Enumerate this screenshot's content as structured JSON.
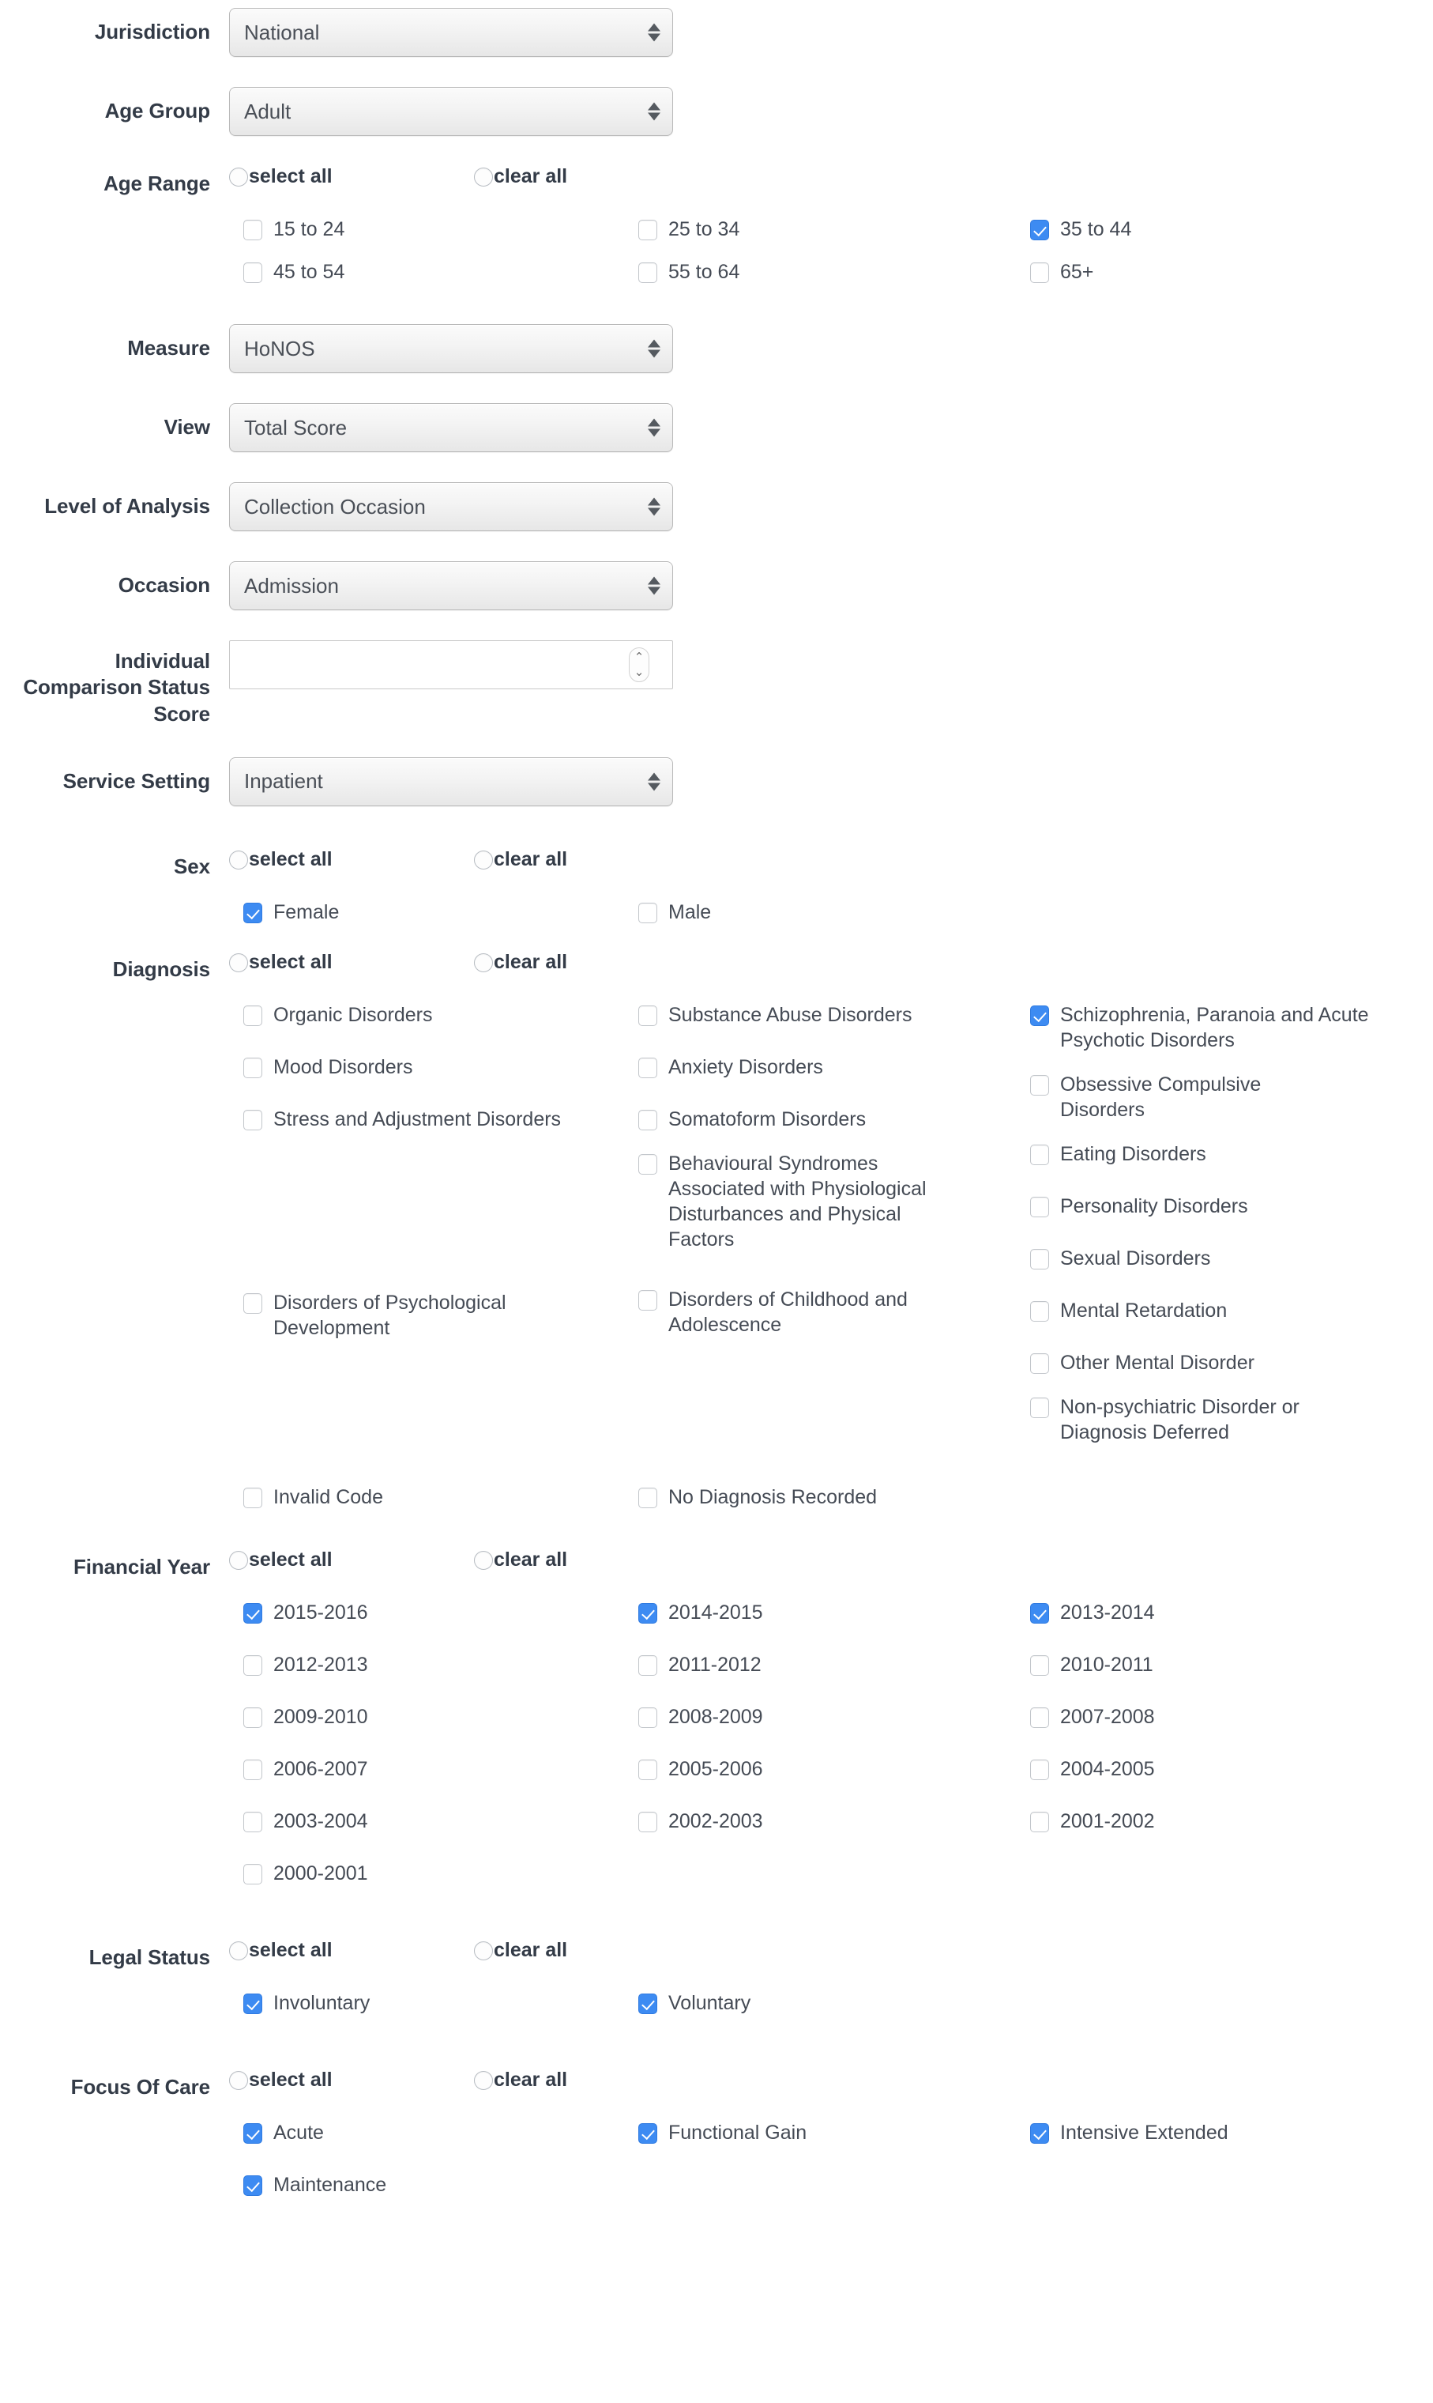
{
  "common": {
    "select_all": "select all",
    "clear_all": "clear all"
  },
  "fields": {
    "jurisdiction": {
      "label": "Jurisdiction",
      "value": "National"
    },
    "age_group": {
      "label": "Age Group",
      "value": "Adult"
    },
    "measure": {
      "label": "Measure",
      "value": "HoNOS"
    },
    "view": {
      "label": "View",
      "value": "Total Score"
    },
    "level_of_analysis": {
      "label": "Level of Analysis",
      "value": "Collection Occasion"
    },
    "occasion": {
      "label": "Occasion",
      "value": "Admission"
    },
    "individual_comparison_status_score": {
      "label": "Individual Comparison Status Score",
      "value": "",
      "placeholder": ""
    },
    "service_setting": {
      "label": "Service Setting",
      "value": "Inpatient"
    }
  },
  "age_range": {
    "label": "Age Range",
    "options": [
      {
        "label": "15 to 24",
        "checked": false
      },
      {
        "label": "25 to 34",
        "checked": false
      },
      {
        "label": "35 to 44",
        "checked": true
      },
      {
        "label": "45 to 54",
        "checked": false
      },
      {
        "label": "55 to 64",
        "checked": false
      },
      {
        "label": "65+",
        "checked": false
      }
    ]
  },
  "sex": {
    "label": "Sex",
    "options": [
      {
        "label": "Female",
        "checked": true
      },
      {
        "label": "Male",
        "checked": false
      }
    ]
  },
  "diagnosis": {
    "label": "Diagnosis",
    "col1": [
      {
        "label": "Organic Disorders",
        "checked": false
      },
      {
        "label": "Mood Disorders",
        "checked": false
      },
      {
        "label": "Stress and Adjustment Disorders",
        "checked": false
      },
      {
        "label": "Disorders of Psychological Development",
        "checked": false
      }
    ],
    "col2": [
      {
        "label": "Substance Abuse Disorders",
        "checked": false
      },
      {
        "label": "Anxiety Disorders",
        "checked": false
      },
      {
        "label": "Somatoform Disorders",
        "checked": false
      },
      {
        "label": "Behavioural Syndromes Associated with Physiological Disturbances and Physical Factors",
        "checked": false
      },
      {
        "label": "Disorders of Childhood and Adolescence",
        "checked": false
      }
    ],
    "col3": [
      {
        "label": "Schizophrenia, Paranoia and Acute Psychotic Disorders",
        "checked": true
      },
      {
        "label": "Obsessive Compulsive Disorders",
        "checked": false
      },
      {
        "label": "Eating Disorders",
        "checked": false
      },
      {
        "label": "Personality Disorders",
        "checked": false
      },
      {
        "label": "Sexual Disorders",
        "checked": false
      },
      {
        "label": "Mental Retardation",
        "checked": false
      },
      {
        "label": "Other Mental Disorder",
        "checked": false
      },
      {
        "label": "Non-psychiatric Disorder or Diagnosis Deferred",
        "checked": false
      }
    ],
    "footer": [
      {
        "label": "Invalid Code",
        "checked": false
      },
      {
        "label": "No Diagnosis Recorded",
        "checked": false
      }
    ]
  },
  "financial_year": {
    "label": "Financial Year",
    "options": [
      {
        "label": "2015-2016",
        "checked": true
      },
      {
        "label": "2014-2015",
        "checked": true
      },
      {
        "label": "2013-2014",
        "checked": true
      },
      {
        "label": "2012-2013",
        "checked": false
      },
      {
        "label": "2011-2012",
        "checked": false
      },
      {
        "label": "2010-2011",
        "checked": false
      },
      {
        "label": "2009-2010",
        "checked": false
      },
      {
        "label": "2008-2009",
        "checked": false
      },
      {
        "label": "2007-2008",
        "checked": false
      },
      {
        "label": "2006-2007",
        "checked": false
      },
      {
        "label": "2005-2006",
        "checked": false
      },
      {
        "label": "2004-2005",
        "checked": false
      },
      {
        "label": "2003-2004",
        "checked": false
      },
      {
        "label": "2002-2003",
        "checked": false
      },
      {
        "label": "2001-2002",
        "checked": false
      },
      {
        "label": "2000-2001",
        "checked": false
      }
    ]
  },
  "legal_status": {
    "label": "Legal Status",
    "options": [
      {
        "label": "Involuntary",
        "checked": true
      },
      {
        "label": "Voluntary",
        "checked": true
      }
    ]
  },
  "focus_of_care": {
    "label": "Focus Of Care",
    "options": [
      {
        "label": "Acute",
        "checked": true
      },
      {
        "label": "Functional Gain",
        "checked": true
      },
      {
        "label": "Intensive Extended",
        "checked": true
      },
      {
        "label": "Maintenance",
        "checked": true
      }
    ]
  },
  "colors": {
    "checkbox_checked": "#3d8bf2",
    "label_text": "#333b47",
    "option_text": "#454b55"
  }
}
